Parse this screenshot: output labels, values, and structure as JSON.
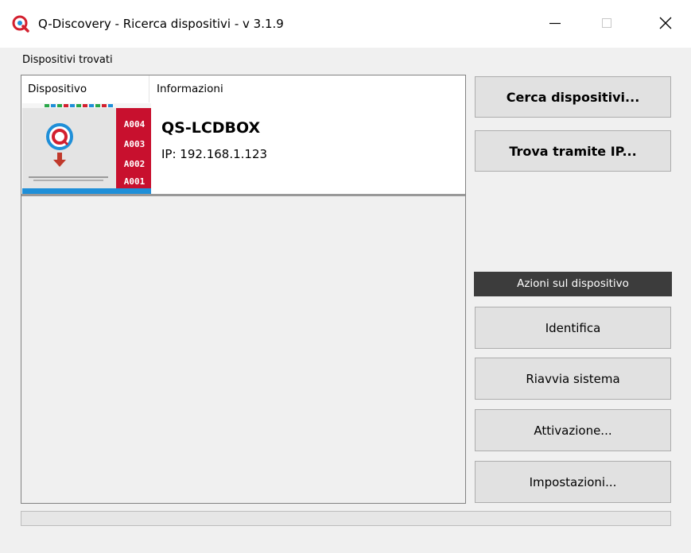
{
  "window": {
    "title": "Q-Discovery - Ricerca dispositivi - v 3.1.9",
    "icon": "q-logo-icon"
  },
  "device_list": {
    "label": "Dispositivi trovati",
    "columns": [
      "Dispositivo",
      "Informazioni"
    ],
    "rows": [
      {
        "thumbnail": "device-display-thumbnail",
        "name": "QS-LCDBOX",
        "ip": "IP: 192.168.1.123",
        "thumb_tickets": [
          "A004",
          "A003",
          "A002",
          "A001"
        ]
      }
    ]
  },
  "buttons": {
    "search": "Cerca dispositivi...",
    "find_by_ip": "Trova tramite IP..."
  },
  "actions": {
    "header": "Azioni sul dispositivo",
    "identify": "Identifica",
    "reboot": "Riavvia sistema",
    "activation": "Attivazione...",
    "settings": "Impostazioni..."
  },
  "progress": {
    "value": 0
  },
  "colors": {
    "accent_red": "#d3202f",
    "logo_blue": "#1f8fd8",
    "actions_header_bg": "#3c3c3c"
  }
}
